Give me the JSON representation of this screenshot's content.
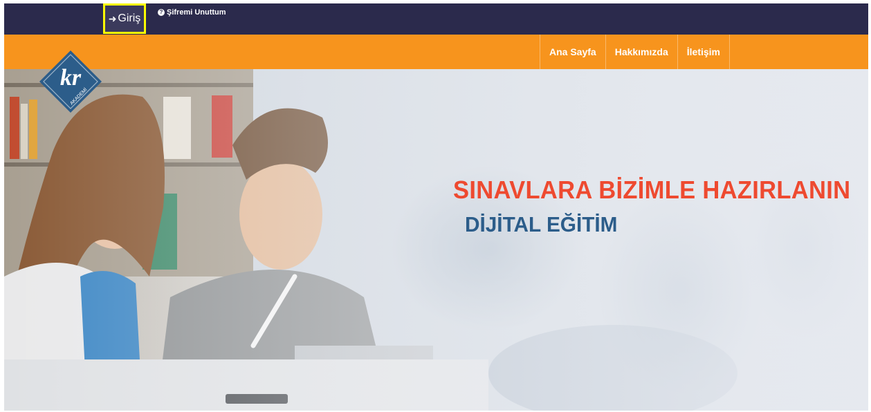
{
  "top_bar": {
    "login_label": "Giriş",
    "login_icon": "sign-in-icon",
    "forgot_label": "Şifremi Unuttum",
    "forgot_icon": "question-circle-icon",
    "highlight_color": "#ffff00",
    "background_color": "#2b2a4c"
  },
  "nav": {
    "background_color": "#f7941d",
    "items": [
      {
        "label": "Ana Sayfa"
      },
      {
        "label": "Hakkımızda"
      },
      {
        "label": "İletişim"
      }
    ]
  },
  "logo": {
    "mark": "kr",
    "subtitle": "AKADEMİ",
    "color": "#2c5d8a"
  },
  "hero": {
    "headline": "SINAVLARA BİZİMLE HAZIRLANIN",
    "subline": "DİJİTAL EĞİTİM",
    "headline_color": "#ee4a30",
    "subline_color": "#2c5d8a"
  }
}
